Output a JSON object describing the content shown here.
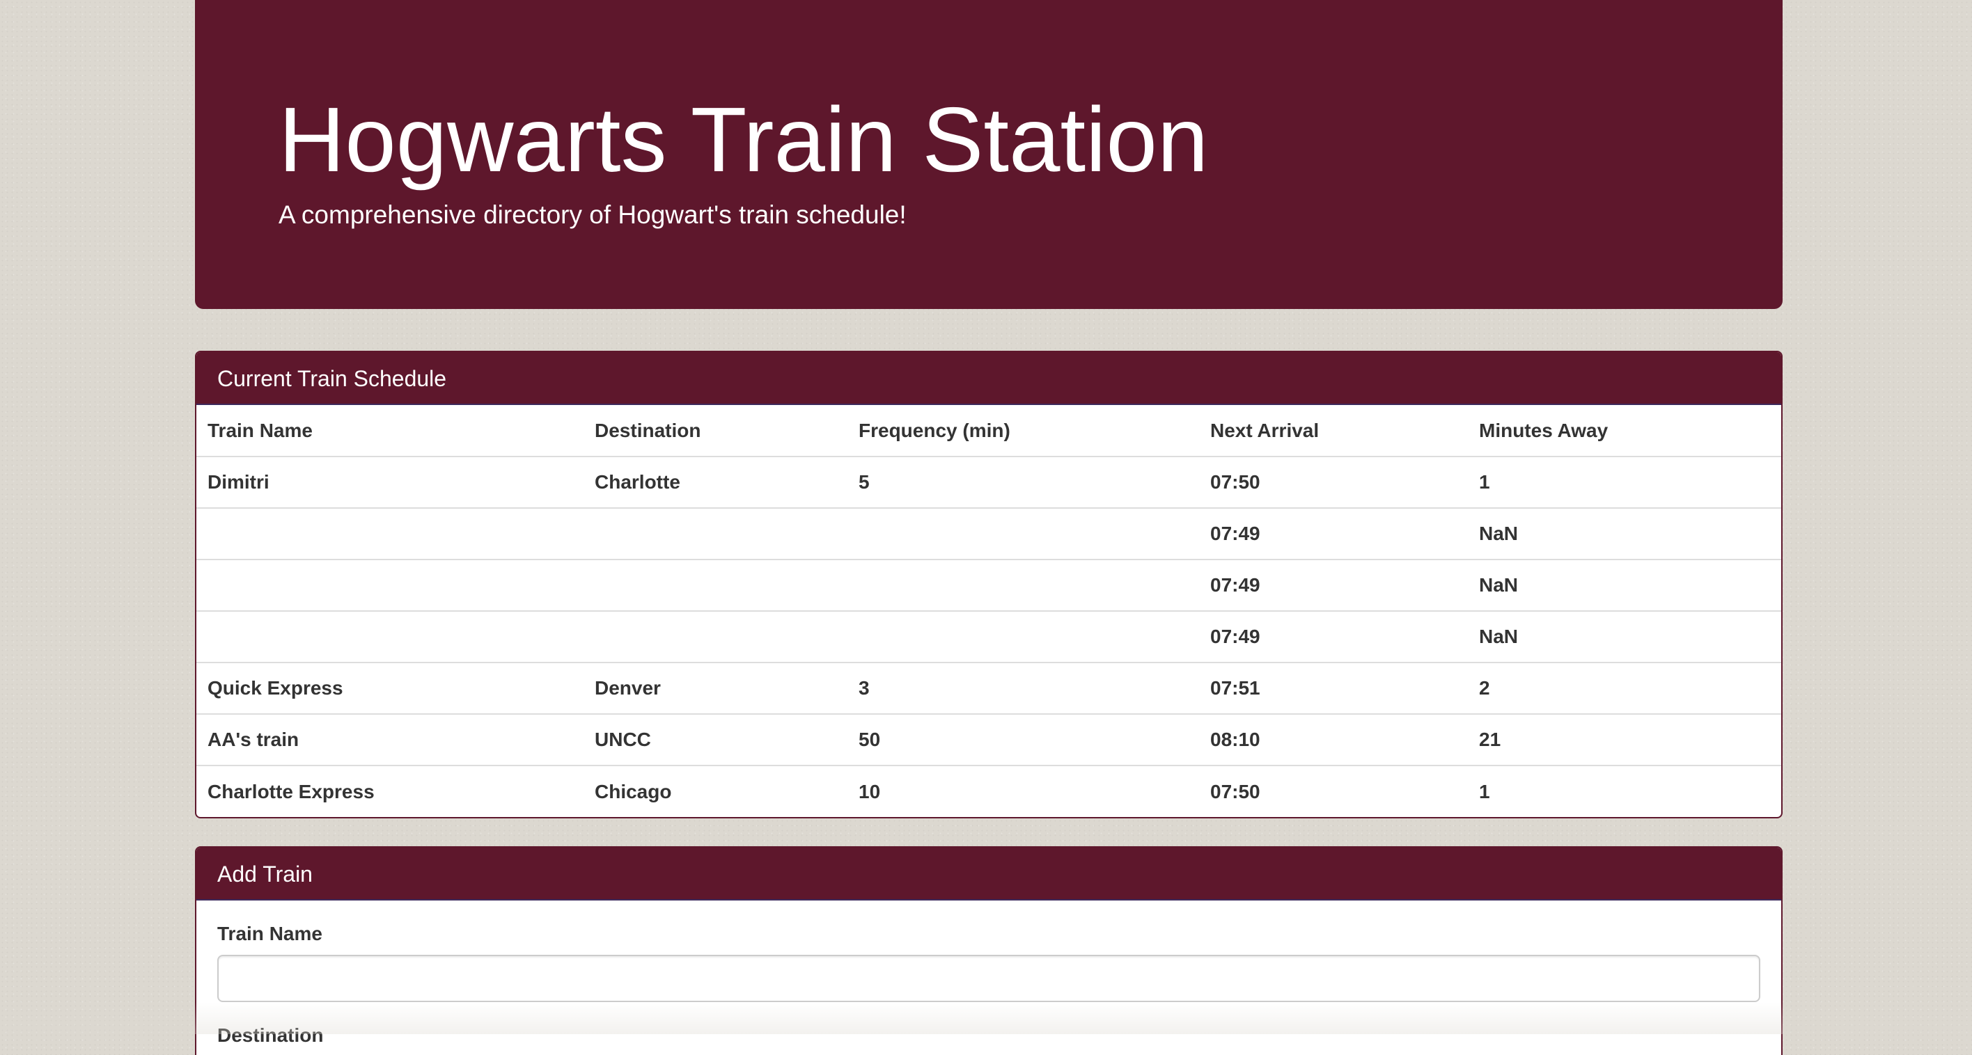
{
  "header": {
    "title": "Hogwarts Train Station",
    "subtitle": "A comprehensive directory of Hogwart's train schedule!"
  },
  "schedule": {
    "panel_title": "Current Train Schedule",
    "columns": [
      "Train Name",
      "Destination",
      "Frequency (min)",
      "Next Arrival",
      "Minutes Away"
    ],
    "rows": [
      [
        "Dimitri",
        "Charlotte",
        "5",
        "07:50",
        "1"
      ],
      [
        "",
        "",
        "",
        "07:49",
        "NaN"
      ],
      [
        "",
        "",
        "",
        "07:49",
        "NaN"
      ],
      [
        "",
        "",
        "",
        "07:49",
        "NaN"
      ],
      [
        "Quick Express",
        "Denver",
        "3",
        "07:51",
        "2"
      ],
      [
        "AA's train",
        "UNCC",
        "50",
        "08:10",
        "21"
      ],
      [
        "Charlotte Express",
        "Chicago",
        "10",
        "07:50",
        "1"
      ]
    ]
  },
  "add_train": {
    "panel_title": "Add Train",
    "fields": [
      {
        "label": "Train Name",
        "value": "",
        "placeholder": ""
      },
      {
        "label": "Destination",
        "value": "",
        "placeholder": ""
      }
    ]
  },
  "colors": {
    "brand": "#5e172c",
    "background": "#dcd8d0",
    "text": "#333333"
  }
}
